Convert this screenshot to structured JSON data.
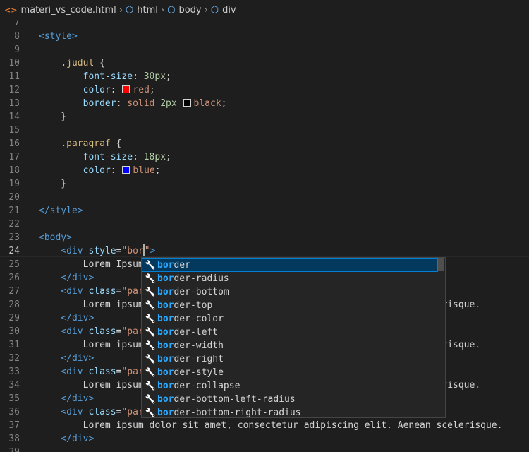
{
  "breadcrumb": [
    {
      "label": "materi_vs_code.html",
      "icon": "html-file-icon"
    },
    {
      "label": "html",
      "icon": "cube-icon"
    },
    {
      "label": "body",
      "icon": "cube-icon"
    },
    {
      "label": "div",
      "icon": "cube-icon"
    }
  ],
  "lines": [
    {
      "n": "7",
      "code": [
        [
          " ",
          "txt"
        ]
      ]
    },
    {
      "n": "8",
      "code": [
        [
          "<style>",
          "tag"
        ]
      ]
    },
    {
      "n": "9",
      "code": [
        [
          " ",
          "txt"
        ]
      ]
    },
    {
      "n": "10",
      "code": [
        [
          "    ",
          "txt"
        ],
        [
          ".judul",
          "sel"
        ],
        [
          " {",
          "txt"
        ]
      ]
    },
    {
      "n": "11",
      "code": [
        [
          "        ",
          "txt"
        ],
        [
          "font-size",
          "prop"
        ],
        [
          ": ",
          "txt"
        ],
        [
          "30px",
          "num"
        ],
        [
          ";",
          "txt"
        ]
      ]
    },
    {
      "n": "12",
      "code": [
        [
          "        ",
          "txt"
        ],
        [
          "color",
          "prop"
        ],
        [
          ": ",
          "txt"
        ],
        [
          "#ff0000",
          "swatch"
        ],
        [
          "red",
          "val"
        ],
        [
          ";",
          "txt"
        ]
      ]
    },
    {
      "n": "13",
      "code": [
        [
          "        ",
          "txt"
        ],
        [
          "border",
          "prop"
        ],
        [
          ": ",
          "txt"
        ],
        [
          "solid",
          "val"
        ],
        [
          " ",
          "txt"
        ],
        [
          "2px",
          "num"
        ],
        [
          " ",
          "txt"
        ],
        [
          "#000000",
          "swatch"
        ],
        [
          "black",
          "val"
        ],
        [
          ";",
          "txt"
        ]
      ]
    },
    {
      "n": "14",
      "code": [
        [
          "    }",
          "txt"
        ]
      ]
    },
    {
      "n": "15",
      "code": [
        [
          " ",
          "txt"
        ]
      ]
    },
    {
      "n": "16",
      "code": [
        [
          "    ",
          "txt"
        ],
        [
          ".paragraf",
          "sel"
        ],
        [
          " {",
          "txt"
        ]
      ]
    },
    {
      "n": "17",
      "code": [
        [
          "        ",
          "txt"
        ],
        [
          "font-size",
          "prop"
        ],
        [
          ": ",
          "txt"
        ],
        [
          "18px",
          "num"
        ],
        [
          ";",
          "txt"
        ]
      ]
    },
    {
      "n": "18",
      "code": [
        [
          "        ",
          "txt"
        ],
        [
          "color",
          "prop"
        ],
        [
          ": ",
          "txt"
        ],
        [
          "#0000ff",
          "swatch"
        ],
        [
          "blue",
          "val"
        ],
        [
          ";",
          "txt"
        ]
      ]
    },
    {
      "n": "19",
      "code": [
        [
          "    }",
          "txt"
        ]
      ]
    },
    {
      "n": "20",
      "code": [
        [
          " ",
          "txt"
        ]
      ]
    },
    {
      "n": "21",
      "code": [
        [
          "</style>",
          "tag"
        ]
      ]
    },
    {
      "n": "22",
      "code": [
        [
          " ",
          "txt"
        ]
      ]
    },
    {
      "n": "23",
      "code": [
        [
          "<body>",
          "tag"
        ]
      ]
    },
    {
      "n": "24",
      "code": [
        [
          "    ",
          "txt"
        ],
        [
          "<div",
          "tag"
        ],
        [
          " ",
          "txt"
        ],
        [
          "style",
          "attr"
        ],
        [
          "=",
          "txt"
        ],
        [
          "\"bor",
          "str"
        ],
        [
          "",
          "cursor"
        ],
        [
          "\"",
          "str"
        ],
        [
          ">",
          "tag"
        ]
      ]
    },
    {
      "n": "25",
      "code": [
        [
          "        ",
          "txt"
        ],
        [
          "Lorem Ipsum",
          "txt"
        ]
      ]
    },
    {
      "n": "26",
      "code": [
        [
          "    ",
          "txt"
        ],
        [
          "</div>",
          "tag"
        ]
      ]
    },
    {
      "n": "27",
      "code": [
        [
          "    ",
          "txt"
        ],
        [
          "<div",
          "tag"
        ],
        [
          " ",
          "txt"
        ],
        [
          "class",
          "attr"
        ],
        [
          "=",
          "txt"
        ],
        [
          "\"par",
          "str"
        ]
      ]
    },
    {
      "n": "28",
      "code": [
        [
          "        ",
          "txt"
        ],
        [
          "Lorem ipsum",
          "txt"
        ],
        [
          "                                                  ",
          "txt"
        ],
        [
          "celerisque.",
          "txt"
        ]
      ]
    },
    {
      "n": "29",
      "code": [
        [
          "    ",
          "txt"
        ],
        [
          "</div>",
          "tag"
        ]
      ]
    },
    {
      "n": "30",
      "code": [
        [
          "    ",
          "txt"
        ],
        [
          "<div",
          "tag"
        ],
        [
          " ",
          "txt"
        ],
        [
          "class",
          "attr"
        ],
        [
          "=",
          "txt"
        ],
        [
          "\"par",
          "str"
        ]
      ]
    },
    {
      "n": "31",
      "code": [
        [
          "        ",
          "txt"
        ],
        [
          "Lorem ipsum",
          "txt"
        ],
        [
          "                                                   ",
          "txt"
        ],
        [
          "elerisque.",
          "txt"
        ]
      ]
    },
    {
      "n": "32",
      "code": [
        [
          "    ",
          "txt"
        ],
        [
          "</div>",
          "tag"
        ]
      ]
    },
    {
      "n": "33",
      "code": [
        [
          "    ",
          "txt"
        ],
        [
          "<div",
          "tag"
        ],
        [
          " ",
          "txt"
        ],
        [
          "class",
          "attr"
        ],
        [
          "=",
          "txt"
        ],
        [
          "\"par",
          "str"
        ]
      ]
    },
    {
      "n": "34",
      "code": [
        [
          "        ",
          "txt"
        ],
        [
          "Lorem ipsum",
          "txt"
        ],
        [
          "                                                   ",
          "txt"
        ],
        [
          "elerisque.",
          "txt"
        ]
      ]
    },
    {
      "n": "35",
      "code": [
        [
          "    ",
          "txt"
        ],
        [
          "</div>",
          "tag"
        ]
      ]
    },
    {
      "n": "36",
      "code": [
        [
          "    ",
          "txt"
        ],
        [
          "<div",
          "tag"
        ],
        [
          " ",
          "txt"
        ],
        [
          "class",
          "attr"
        ],
        [
          "=",
          "txt"
        ],
        [
          "\"par",
          "str"
        ]
      ]
    },
    {
      "n": "37",
      "code": [
        [
          "        ",
          "txt"
        ],
        [
          "Lorem ipsum dolor sit amet, consectetur adipiscing elit. Aenean scelerisque.",
          "txt"
        ]
      ]
    },
    {
      "n": "38",
      "code": [
        [
          "    ",
          "txt"
        ],
        [
          "</div>",
          "tag"
        ]
      ]
    },
    {
      "n": "39",
      "code": [
        [
          " ",
          "txt"
        ]
      ]
    }
  ],
  "active_line": "24",
  "suggestions": {
    "typed": "bor",
    "items": [
      {
        "match": "bor",
        "rest": "der",
        "icon": "wrench-icon"
      },
      {
        "match": "bor",
        "rest": "der-radius",
        "icon": "wrench-icon"
      },
      {
        "match": "bor",
        "rest": "der-bottom",
        "icon": "wrench-icon"
      },
      {
        "match": "bor",
        "rest": "der-top",
        "icon": "wrench-icon"
      },
      {
        "match": "bor",
        "rest": "der-color",
        "icon": "wrench-icon"
      },
      {
        "match": "bor",
        "rest": "der-left",
        "icon": "wrench-icon"
      },
      {
        "match": "bor",
        "rest": "der-width",
        "icon": "wrench-icon"
      },
      {
        "match": "bor",
        "rest": "der-right",
        "icon": "wrench-icon"
      },
      {
        "match": "bor",
        "rest": "der-style",
        "icon": "wrench-icon"
      },
      {
        "match": "bor",
        "rest": "der-collapse",
        "icon": "wrench-icon"
      },
      {
        "match": "bor",
        "rest": "der-bottom-left-radius",
        "icon": "wrench-icon"
      },
      {
        "match": "bor",
        "rest": "der-bottom-right-radius",
        "icon": "wrench-icon"
      }
    ]
  }
}
